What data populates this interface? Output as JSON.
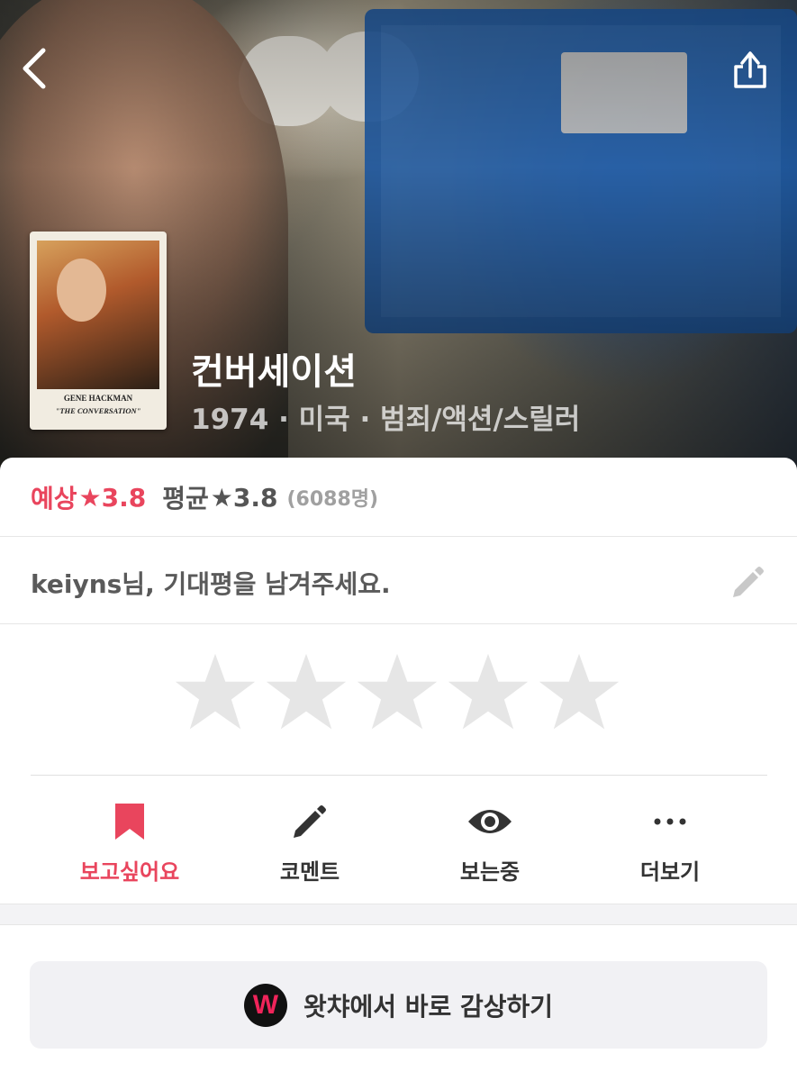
{
  "hero": {
    "title": "컨버세이션",
    "meta": "1974 · 미국 · 범죄/액션/스릴러"
  },
  "poster": {
    "name": "GENE HACKMAN",
    "title": "\"THE CONVERSATION\""
  },
  "rating": {
    "predicted_label": "예상",
    "predicted_value": "3.8",
    "average_label": "평균",
    "average_value": "3.8",
    "count": "(6088명)"
  },
  "prompt": {
    "text": "keiyns님, 기대평을 남겨주세요."
  },
  "actions": [
    {
      "label": "보고싶어요",
      "icon": "bookmark-icon",
      "active": true
    },
    {
      "label": "코멘트",
      "icon": "pencil-icon",
      "active": false
    },
    {
      "label": "보는중",
      "icon": "eye-icon",
      "active": false
    },
    {
      "label": "더보기",
      "icon": "more-icon",
      "active": false
    }
  ],
  "watch": {
    "logo": "W",
    "label": "왓챠에서 바로 감상하기"
  },
  "colors": {
    "accent": "#e9455d",
    "star_empty": "#e6e6e6",
    "button_bg": "#f1f1f4"
  }
}
